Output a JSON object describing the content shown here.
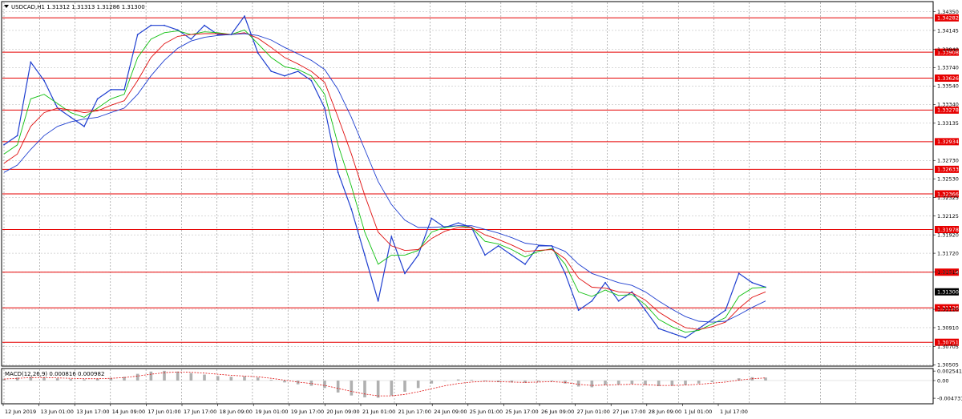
{
  "header": {
    "title": "USDCAD,H1  1.31312 1.31313 1.31286 1.31300"
  },
  "macd_header": {
    "title": "MACD(12,26,9) 0.000816 0.000982"
  },
  "chart_data": [
    {
      "type": "line",
      "title": "USDCAD,H1",
      "series": [
        {
          "name": "USDCAD",
          "color": "#1f3fd0",
          "values": [
            1.329,
            1.33,
            1.338,
            1.336,
            1.333,
            1.332,
            1.331,
            1.334,
            1.335,
            1.335,
            1.341,
            1.342,
            1.342,
            1.3415,
            1.3405,
            1.342,
            1.341,
            1.341,
            1.343,
            1.339,
            1.337,
            1.3365,
            1.337,
            1.336,
            1.333,
            1.326,
            1.322,
            1.317,
            1.312,
            1.319,
            1.315,
            1.317,
            1.321,
            1.32,
            1.3205,
            1.32,
            1.317,
            1.318,
            1.317,
            1.316,
            1.318,
            1.318,
            1.315,
            1.311,
            1.312,
            1.314,
            1.312,
            1.313,
            1.311,
            1.309,
            1.3085,
            1.308,
            1.309,
            1.31,
            1.311,
            1.315,
            1.314,
            1.3135
          ]
        },
        {
          "name": "MA fast",
          "color": "#10c010",
          "values": [
            1.328,
            1.329,
            1.334,
            1.3345,
            1.3335,
            1.3325,
            1.332,
            1.333,
            1.334,
            1.3345,
            1.3385,
            1.3405,
            1.3412,
            1.3414,
            1.341,
            1.3413,
            1.3412,
            1.341,
            1.3415,
            1.34,
            1.3385,
            1.3375,
            1.3372,
            1.3365,
            1.3345,
            1.329,
            1.3245,
            1.3195,
            1.316,
            1.317,
            1.317,
            1.3175,
            1.3195,
            1.32,
            1.3202,
            1.32,
            1.3185,
            1.3182,
            1.3176,
            1.3168,
            1.3174,
            1.3177,
            1.316,
            1.313,
            1.3125,
            1.3132,
            1.3126,
            1.3127,
            1.3116,
            1.31,
            1.3092,
            1.3086,
            1.3088,
            1.3095,
            1.3102,
            1.3125,
            1.3134,
            1.3135
          ]
        },
        {
          "name": "MA mid",
          "color": "#e01010",
          "values": [
            1.327,
            1.328,
            1.331,
            1.3325,
            1.333,
            1.3328,
            1.3325,
            1.3327,
            1.3333,
            1.3338,
            1.336,
            1.3385,
            1.34,
            1.3408,
            1.341,
            1.3411,
            1.3411,
            1.341,
            1.3412,
            1.3406,
            1.3396,
            1.3385,
            1.3378,
            1.337,
            1.3358,
            1.332,
            1.328,
            1.3235,
            1.3195,
            1.318,
            1.3175,
            1.3176,
            1.3188,
            1.3196,
            1.32,
            1.32,
            1.3192,
            1.3187,
            1.3181,
            1.3174,
            1.3175,
            1.3176,
            1.3166,
            1.3145,
            1.3135,
            1.3134,
            1.313,
            1.3129,
            1.3121,
            1.3108,
            1.3099,
            1.3091,
            1.3089,
            1.3092,
            1.3097,
            1.3112,
            1.3124,
            1.313
          ]
        },
        {
          "name": "MA slow",
          "color": "#1f3fd0",
          "values": [
            1.326,
            1.3268,
            1.3285,
            1.33,
            1.331,
            1.3315,
            1.3318,
            1.332,
            1.3325,
            1.333,
            1.3345,
            1.3365,
            1.3382,
            1.3395,
            1.3403,
            1.3407,
            1.3409,
            1.341,
            1.3411,
            1.3409,
            1.3404,
            1.3396,
            1.3389,
            1.3382,
            1.3372,
            1.335,
            1.332,
            1.3285,
            1.325,
            1.3225,
            1.3208,
            1.32,
            1.32,
            1.3201,
            1.3202,
            1.3202,
            1.3198,
            1.3194,
            1.3189,
            1.3183,
            1.3181,
            1.318,
            1.3174,
            1.316,
            1.315,
            1.3145,
            1.314,
            1.3137,
            1.313,
            1.312,
            1.3111,
            1.3103,
            1.3098,
            1.3097,
            1.3098,
            1.3105,
            1.3113,
            1.312
          ]
        }
      ],
      "ylim": [
        1.305,
        1.3445
      ],
      "y_ticks": [
        "1.34350",
        "1.34145",
        "1.33940",
        "1.33740",
        "1.33540",
        "1.33340",
        "1.33135",
        "1.32730",
        "1.32530",
        "1.32325",
        "1.32125",
        "1.31920",
        "1.31720",
        "1.31515",
        "1.31110",
        "1.30910",
        "1.30705",
        "1.30505"
      ],
      "y_tick_values": [
        1.3435,
        1.34145,
        1.3394,
        1.3374,
        1.3354,
        1.3334,
        1.33135,
        1.3273,
        1.3253,
        1.32325,
        1.32125,
        1.3192,
        1.3172,
        1.31515,
        1.3111,
        1.3091,
        1.30705,
        1.30505
      ],
      "horizontal_levels": [
        {
          "label": "1.34282",
          "value": 1.34282
        },
        {
          "label": "1.33908",
          "value": 1.33908
        },
        {
          "label": "1.33626",
          "value": 1.33626
        },
        {
          "label": "1.33278",
          "value": 1.33278
        },
        {
          "label": "1.32934",
          "value": 1.32934
        },
        {
          "label": "1.32633",
          "value": 1.32633
        },
        {
          "label": "1.32366",
          "value": 1.32366
        },
        {
          "label": "1.31978",
          "value": 1.31978
        },
        {
          "label": "1.31514",
          "value": 1.31514
        },
        {
          "label": "1.31126",
          "value": 1.31126
        },
        {
          "label": "1.30751",
          "value": 1.30751
        }
      ],
      "current_price": {
        "label": "1.31300",
        "value": 1.313
      },
      "x_tick_labels": [
        "12 Jun 2019",
        "13 Jun 01:00",
        "13 Jun 17:00",
        "14 Jun 09:00",
        "17 Jun 01:00",
        "17 Jun 17:00",
        "18 Jun 09:00",
        "19 Jun 01:00",
        "19 Jun 17:00",
        "20 Jun 09:00",
        "21 Jun 01:00",
        "21 Jun 17:00",
        "24 Jun 09:00",
        "25 Jun 01:00",
        "25 Jun 17:00",
        "26 Jun 09:00",
        "27 Jun 01:00",
        "27 Jun 17:00",
        "28 Jun 09:00",
        "1 Jul 01:00",
        "1 Jul 17:00"
      ],
      "grid": true,
      "colors": {
        "level": "#e60000",
        "label_bg": "#e60000",
        "price_bg": "#000000",
        "grid": "#b8b8b8"
      }
    },
    {
      "type": "bar",
      "title": "MACD(12,26,9)",
      "series": [
        {
          "name": "MACD",
          "color": "#b0b0b0",
          "values": [
            0.0005,
            0.0008,
            0.001,
            0.0008,
            0.0006,
            0.0004,
            0.0003,
            0.0005,
            0.0007,
            0.001,
            0.0018,
            0.0024,
            0.0026,
            0.0024,
            0.002,
            0.0016,
            0.0012,
            0.001,
            0.0011,
            0.0008,
            0.0002,
            -0.0005,
            -0.001,
            -0.0014,
            -0.002,
            -0.0032,
            -0.004,
            -0.0045,
            -0.0046,
            -0.004,
            -0.003,
            -0.002,
            -0.0008,
            0.0,
            0.0003,
            0.0002,
            -0.0002,
            -0.0004,
            -0.0005,
            -0.0006,
            -0.0003,
            -0.0002,
            -0.0008,
            -0.0016,
            -0.0018,
            -0.0012,
            -0.0011,
            -0.0009,
            -0.0012,
            -0.0015,
            -0.0014,
            -0.0012,
            -0.0008,
            -0.0004,
            0.0,
            0.0006,
            0.0009,
            0.0008
          ]
        },
        {
          "name": "Signal",
          "color": "#e01010",
          "values": [
            0.0004,
            0.0006,
            0.0008,
            0.0008,
            0.0007,
            0.0006,
            0.0005,
            0.0005,
            0.0006,
            0.0008,
            0.0012,
            0.0017,
            0.0021,
            0.0023,
            0.0022,
            0.002,
            0.0017,
            0.0014,
            0.0012,
            0.001,
            0.0006,
            0.0001,
            -0.0004,
            -0.0008,
            -0.0013,
            -0.0021,
            -0.0029,
            -0.0036,
            -0.0041,
            -0.0041,
            -0.0037,
            -0.003,
            -0.0022,
            -0.0014,
            -0.0008,
            -0.0004,
            -0.0002,
            -0.0003,
            -0.0004,
            -0.0005,
            -0.0004,
            -0.0003,
            -0.0005,
            -0.001,
            -0.0013,
            -0.0012,
            -0.0011,
            -0.001,
            -0.0011,
            -0.0013,
            -0.0013,
            -0.0012,
            -0.001,
            -0.0007,
            -0.0004,
            0.0001,
            0.0005,
            0.0007
          ]
        }
      ],
      "ylim": [
        -0.006,
        0.003
      ],
      "y_ticks": [
        "0.002541",
        "0.00",
        "-0.004731"
      ],
      "y_tick_values": [
        0.002541,
        0.0,
        -0.004731
      ]
    }
  ]
}
